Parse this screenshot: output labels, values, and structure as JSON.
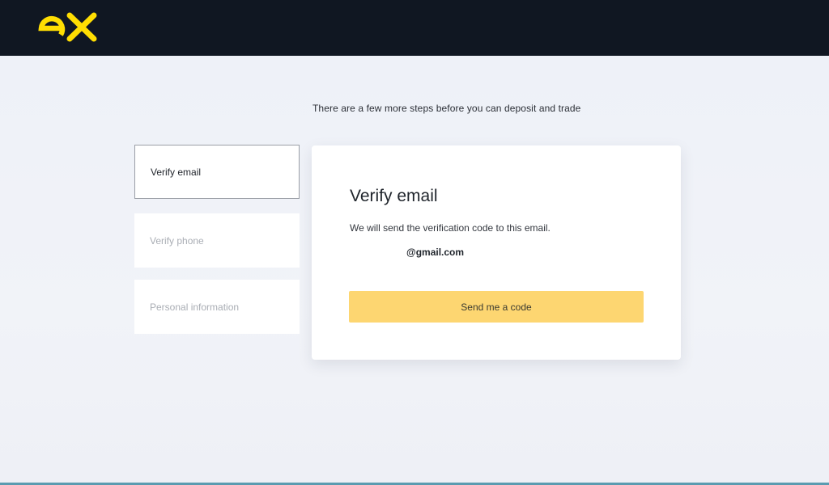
{
  "header": {
    "logo_icon": "exness-ex-logo-icon",
    "logo_color": "#ffde02",
    "background": "#101722"
  },
  "intro_text": "There are a few more steps before you can deposit and trade",
  "steps": [
    {
      "label": "Verify email",
      "state": "active"
    },
    {
      "label": "Verify phone",
      "state": "pending"
    },
    {
      "label": "Personal information",
      "state": "pending"
    }
  ],
  "card": {
    "title": "Verify email",
    "description": "We will send the verification code to this email.",
    "email": "@gmail.com",
    "button_label": "Send me a code",
    "button_color": "#fdd671"
  }
}
